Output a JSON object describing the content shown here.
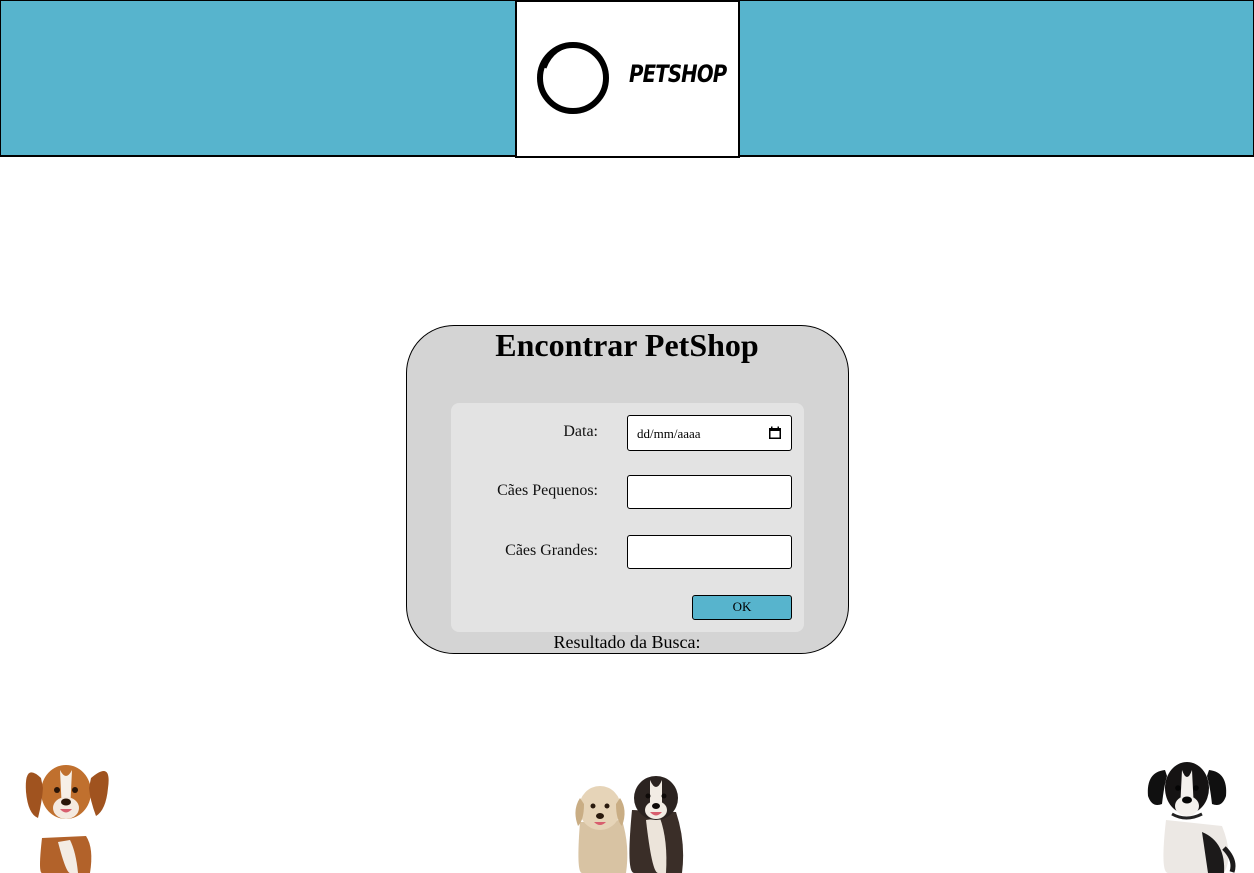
{
  "header": {
    "logo_text": "PETSHOP"
  },
  "search_card": {
    "title": "Encontrar PetShop",
    "date_label": "Data:",
    "date_placeholder": "dd/mm/aaaa",
    "small_dogs_label": "Cães Pequenos:",
    "small_dogs_value": "",
    "large_dogs_label": "Cães Grandes:",
    "large_dogs_value": "",
    "ok_label": "OK",
    "result_label": "Resultado da Busca:"
  },
  "colors": {
    "header_bg": "#57b4cd",
    "card_bg": "#d4d4d4",
    "panel_bg": "#e3e3e3",
    "button_bg": "#57b4cd"
  },
  "icons": [
    "logo-ring-icon",
    "calendar-icon"
  ],
  "images": [
    "dog-left-image",
    "dogs-center-image",
    "dog-right-image"
  ]
}
